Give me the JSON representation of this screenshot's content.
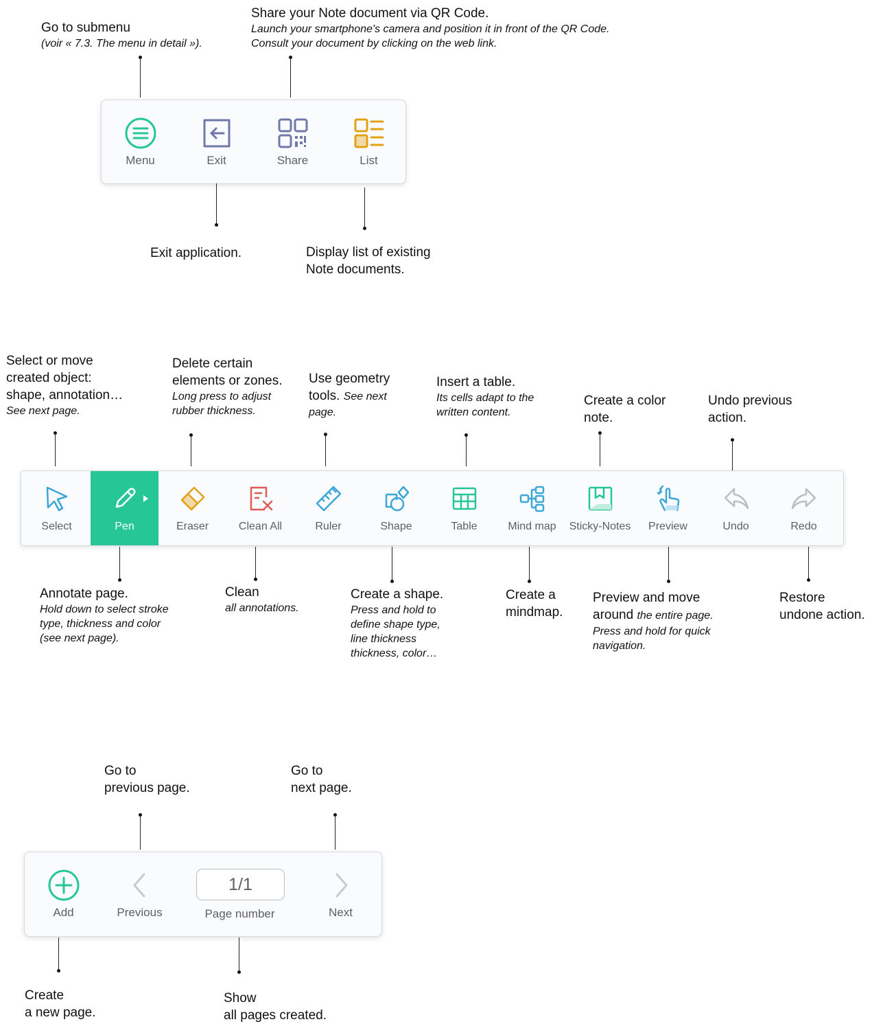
{
  "top_menu": {
    "buttons": [
      {
        "label": "Menu"
      },
      {
        "label": "Exit"
      },
      {
        "label": "Share"
      },
      {
        "label": "List"
      }
    ],
    "annotations": {
      "menu": {
        "line1": "Go to submenu",
        "line2": "(voir « 7.3. The menu in detail »)."
      },
      "share": {
        "line1": "Share your Note document via QR Code.",
        "line2": "Launch your smartphone's camera and position it in front of the QR Code.",
        "line3": "Consult your document by clicking on the web link."
      },
      "exit": {
        "line1": "Exit application."
      },
      "list": {
        "line1": "Display list of existing",
        "line2": "Note documents."
      }
    }
  },
  "toolbar": {
    "accent_color": "#26c696",
    "buttons": [
      {
        "label": "Select",
        "icon": "cursor-arrow"
      },
      {
        "label": "Pen",
        "icon": "pen",
        "active": true
      },
      {
        "label": "Eraser",
        "icon": "eraser"
      },
      {
        "label": "Clean All",
        "icon": "clean-all"
      },
      {
        "label": "Ruler",
        "icon": "ruler"
      },
      {
        "label": "Shape",
        "icon": "shape"
      },
      {
        "label": "Table",
        "icon": "table"
      },
      {
        "label": "Mind map",
        "icon": "mind-map"
      },
      {
        "label": "Sticky-Notes",
        "icon": "sticky-note"
      },
      {
        "label": "Preview",
        "icon": "hand-preview"
      },
      {
        "label": "Undo",
        "icon": "undo"
      },
      {
        "label": "Redo",
        "icon": "redo"
      }
    ],
    "annotations_top": {
      "select": {
        "l1": "Select or move",
        "l2": "created object:",
        "l3": "shape, annotation…",
        "l4": "See next page."
      },
      "eraser": {
        "l1": "Delete certain",
        "l2": "elements or zones.",
        "l3": "Long press to adjust",
        "l4": "rubber thickness."
      },
      "ruler": {
        "l1": "Use geometry",
        "l2a": "tools.",
        "l2b": "See next",
        "l3": "page."
      },
      "table": {
        "l1": "Insert a table.",
        "l2": "Its cells adapt to the",
        "l3": "written content."
      },
      "sticky": {
        "l1": "Create a color",
        "l2": "note."
      },
      "undo": {
        "l1": "Undo previous",
        "l2": "action."
      }
    },
    "annotations_bottom": {
      "pen": {
        "l1": "Annotate page.",
        "l2": "Hold down to select stroke",
        "l3": "type, thickness and color",
        "l4": "(see next page)."
      },
      "clean": {
        "l1": "Clean",
        "l2": "all annotations."
      },
      "shape": {
        "l1": "Create a shape.",
        "l2": "Press and hold to",
        "l3": "define shape type,",
        "l4": "line thickness",
        "l5": "thickness, color…"
      },
      "mindmap": {
        "l1": "Create a",
        "l2": "mindmap."
      },
      "preview": {
        "l1": "Preview and move",
        "l2a": "around",
        "l2b": "the entire page.",
        "l3": "Press and hold for quick",
        "l4": "navigation."
      },
      "redo": {
        "l1": "Restore",
        "l2": "undone action."
      }
    }
  },
  "page_nav": {
    "add_label": "Add",
    "previous_label": "Previous",
    "page_value": "1/1",
    "page_label": "Page number",
    "next_label": "Next",
    "annotations": {
      "previous": {
        "l1": "Go to",
        "l2": "previous page."
      },
      "next": {
        "l1": "Go to",
        "l2": "next page."
      },
      "add": {
        "l1": "Create",
        "l2": "a new page."
      },
      "page": {
        "l1": "Show",
        "l2": "all pages created."
      }
    }
  }
}
